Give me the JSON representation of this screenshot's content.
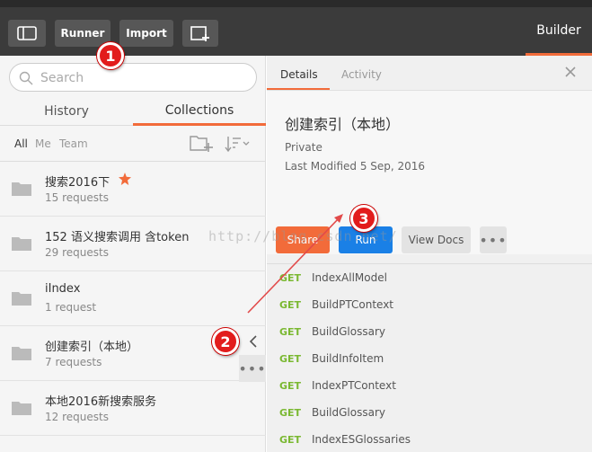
{
  "toolbar": {
    "runner_label": "Runner",
    "import_label": "Import",
    "builder_label": "Builder"
  },
  "sidebar": {
    "search_placeholder": "Search",
    "tabs": {
      "history": "History",
      "collections": "Collections"
    },
    "filters": {
      "all": "All",
      "me": "Me",
      "team": "Team"
    },
    "collections": [
      {
        "name": "搜索2016下",
        "count": "15 requests",
        "starred": true
      },
      {
        "name": "152 语义搜索调用 含token",
        "count": "29 requests"
      },
      {
        "name": "iIndex",
        "count": "1 request"
      },
      {
        "name": "创建索引（本地）",
        "count": "7 requests"
      },
      {
        "name": "本地2016新搜索服务",
        "count": "12 requests"
      }
    ]
  },
  "panel": {
    "tabs": {
      "details": "Details",
      "activity": "Activity"
    },
    "title": "创建索引（本地）",
    "privacy": "Private",
    "modified": "Last Modified 5 Sep, 2016",
    "buttons": {
      "share": "Share",
      "run": "Run",
      "docs": "View Docs"
    },
    "requests": [
      {
        "method": "GET",
        "name": "IndexAllModel"
      },
      {
        "method": "GET",
        "name": "BuildPTContext"
      },
      {
        "method": "GET",
        "name": "BuildGlossary"
      },
      {
        "method": "GET",
        "name": "BuildInfoItem"
      },
      {
        "method": "GET",
        "name": "IndexPTContext"
      },
      {
        "method": "GET",
        "name": "BuildGlossary"
      },
      {
        "method": "GET",
        "name": "IndexESGlossaries"
      }
    ]
  },
  "annotations": {
    "badge1": "1",
    "badge2": "2",
    "badge3": "3"
  },
  "watermark": "http://blog.csdn.net/",
  "colors": {
    "accent": "#f26b3a",
    "run": "#1a80e6",
    "get": "#7ab831",
    "badge": "#e21c1c"
  }
}
